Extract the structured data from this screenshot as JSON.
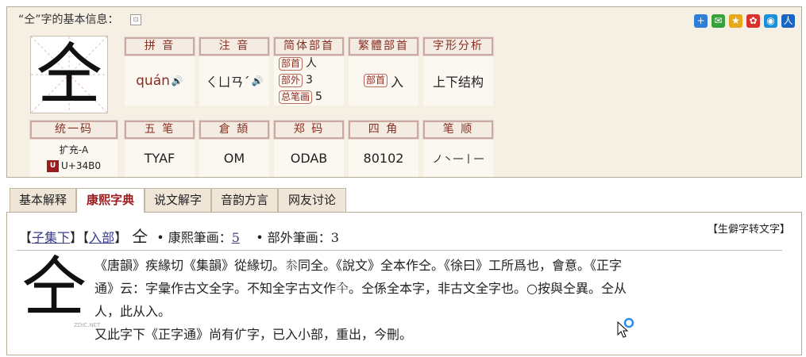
{
  "info": {
    "title": "“仝”字的基本信息：",
    "pin_icon": "pin-icon",
    "character": "仝",
    "share_icons": [
      {
        "name": "share-plus-icon",
        "glyph": "+",
        "color": "#2d7fd8"
      },
      {
        "name": "wechat-icon",
        "glyph": "✉",
        "color": "#36a23a"
      },
      {
        "name": "qzone-icon",
        "glyph": "★",
        "color": "#e8a81c"
      },
      {
        "name": "weibo-icon",
        "glyph": "✿",
        "color": "#d9322c"
      },
      {
        "name": "tencent-icon",
        "glyph": "◉",
        "color": "#1c8fd8"
      },
      {
        "name": "renren-icon",
        "glyph": "人",
        "color": "#1a64c4"
      }
    ],
    "labels": {
      "pinyin": "拼 音",
      "zhuyin": "注 音",
      "simplified_radical": "简体部首",
      "traditional_radical": "繁體部首",
      "structure": "字形分析",
      "unicode": "统一码",
      "wubi": "五 笔",
      "cangjie": "倉 頡",
      "zhengma": "郑 码",
      "sijiao": "四 角",
      "bishun": "笔 顺"
    },
    "values": {
      "pinyin": "quán",
      "zhuyin": "ㄑㄩㄢˊ",
      "radical_tag": "部首",
      "radical": "人",
      "strokes_outside_tag": "部外",
      "strokes_outside": "3",
      "total_strokes_tag": "总笔画",
      "total_strokes": "5",
      "trad_radical_tag": "部首",
      "trad_radical": "入",
      "structure": "上下结构",
      "unicode_block": "扩充-A",
      "unicode_code": "U+34B0",
      "unicode_logo": "U",
      "wubi": "TYAF",
      "cangjie": "OM",
      "zhengma": "ODAB",
      "sijiao": "80102",
      "bishun": "ノ丶一丨一"
    }
  },
  "tabs": [
    {
      "label": "基本解释",
      "active": false
    },
    {
      "label": "康熙字典",
      "active": true
    },
    {
      "label": "说文解字",
      "active": false
    },
    {
      "label": "音韵方言",
      "active": false
    },
    {
      "label": "网友讨论",
      "active": false
    }
  ],
  "kangxi": {
    "bracket_open": "【",
    "bracket_close": "】",
    "collection": "子集下",
    "radical_link": "入部",
    "character": "仝",
    "strokes_label": "• 康熙筆画：",
    "strokes_value": "5",
    "outside_label": "• 部外筆画：",
    "outside_value": "3",
    "convert_link": "【生僻字转文字】",
    "seal_char": "仝",
    "seal_credit": "ZDIC.NET",
    "body_lines": [
      "《唐韻》疾緣切《集韻》從緣切。𠫭同全。《說文》全本作仝。《徐曰》工所爲也，會意。《正字",
      "通》云：字彙作古文全字。不知全字古文作𠓝。仝係全本字，非古文全字也。○按與仝異。仝从",
      "人，此从入。",
      "又此字下《正字通》尚有𠆲字，已入小部，重出，今刪。"
    ]
  }
}
